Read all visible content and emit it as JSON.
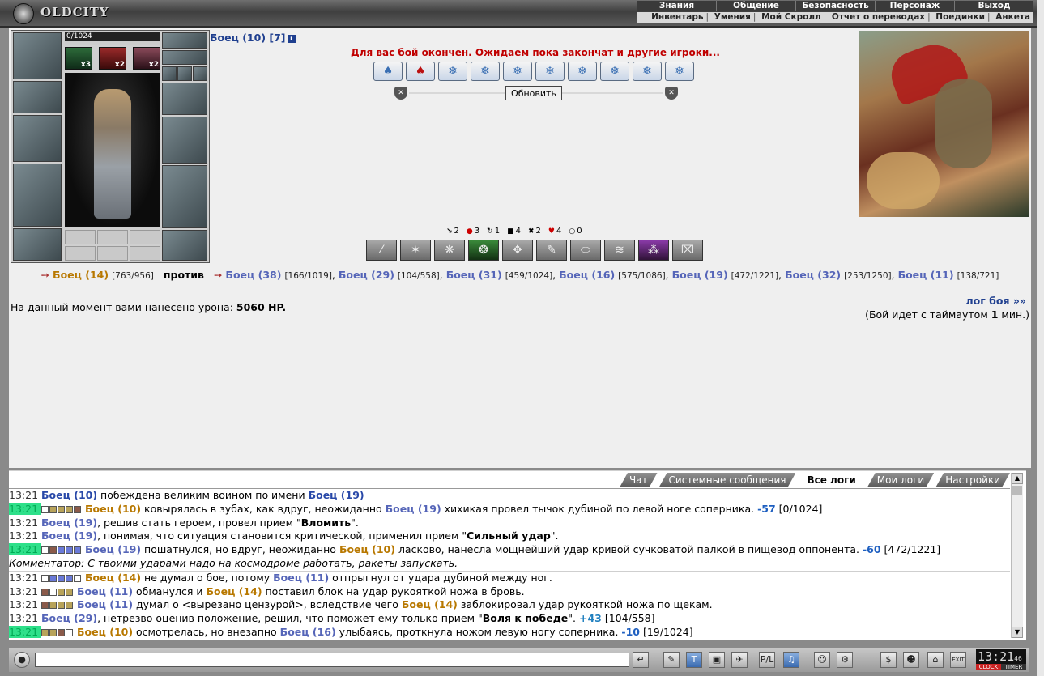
{
  "header": {
    "logo_text": "OLDCITY",
    "top_nav": [
      "Знания",
      "Общение",
      "Безопасность",
      "Персонаж",
      "Выход"
    ],
    "sub_nav": [
      "Инвентарь",
      "Умения",
      "Мой Скролл",
      "Отчет о переводах",
      "Поединки",
      "Анкета"
    ]
  },
  "character": {
    "hp_text": "0/1024",
    "hp_fraction": 0.0,
    "buffs": [
      {
        "count": "x3"
      },
      {
        "count": "x2"
      },
      {
        "count": "x2"
      }
    ],
    "name": "Боец (10) [7]",
    "info_icon": "i"
  },
  "battle": {
    "message": "Для вас бой окончен. Ожидаем пока закончат и другие игроки...",
    "refresh_label": "Обновить",
    "stats": [
      {
        "icon": "↘",
        "value": "2"
      },
      {
        "icon": "●",
        "value": "3",
        "color": "#c00000"
      },
      {
        "icon": "↻",
        "value": "1"
      },
      {
        "icon": "■",
        "value": "4"
      },
      {
        "icon": "✖",
        "value": "2"
      },
      {
        "icon": "♥",
        "value": "4",
        "color": "#c00000"
      },
      {
        "icon": "○",
        "value": "0"
      }
    ]
  },
  "versus": {
    "me": {
      "name": "Боец (14)",
      "hp": "[763/956]"
    },
    "vs_label": "против",
    "enemies": [
      {
        "name": "Боец (38)",
        "hp": "[166/1019]"
      },
      {
        "name": "Боец (29)",
        "hp": "[104/558]"
      },
      {
        "name": "Боец (31)",
        "hp": "[459/1024]"
      },
      {
        "name": "Боец (16)",
        "hp": "[575/1086]"
      },
      {
        "name": "Боец (19)",
        "hp": "[472/1221]"
      },
      {
        "name": "Боец (32)",
        "hp": "[253/1250]"
      },
      {
        "name": "Боец (11)",
        "hp": "[138/721]"
      }
    ]
  },
  "damage": {
    "prefix": "На данный момент вами нанесено урона:",
    "value": "5060 HP."
  },
  "battle_log_link": "лог боя »»",
  "timeout": {
    "prefix": "(Бой идет с таймаутом",
    "value": "1",
    "suffix": "мин.)"
  },
  "log_tabs": [
    "Чат",
    "Системные сообщения",
    "Все логи",
    "Мои логи",
    "Настройки"
  ],
  "log_active_tab": "Все логи",
  "log": {
    "r1": {
      "t": "13:21",
      "a": "Боец (10)",
      "b": " побеждена великим воином по имени ",
      "c": "Боец (19)"
    },
    "r2": {
      "t": "13:21",
      "a": "Боец (10)",
      "b": " ковырялась в зубах, как вдруг, неожиданно ",
      "c": "Боец (19)",
      "d": " хихикая провел тычок дубиной по левой ноге соперника. ",
      "e": "-57",
      "f": " [0/1024]"
    },
    "r3": {
      "t": "13:21",
      "a": "Боец (19)",
      "b": ", решив стать героем, провел прием \"",
      "c": "Вломить",
      "d": "\"."
    },
    "r4": {
      "t": "13:21",
      "a": "Боец (19)",
      "b": ", понимая, что ситуация становится критической, применил прием \"",
      "c": "Сильный удар",
      "d": "\"."
    },
    "r5": {
      "t": "13:21",
      "a": "Боец (19)",
      "b": " пошатнулся, но вдруг, неожиданно ",
      "c": "Боец (10)",
      "d": " ласково, нанесла мощнейший удар кривой сучковатой палкой в пищевод оппонента. ",
      "e": "-60",
      "f": " [472/1221]"
    },
    "r6": {
      "text": "Комментатор: С твоими ударами надо на космодроме работать, ракеты запускать."
    },
    "r7": {
      "t": "13:21",
      "a": "Боец (14)",
      "b": " не думал о бое, потому ",
      "c": "Боец (11)",
      "d": " отпрыгнул от удара дубиной между ног."
    },
    "r8": {
      "t": "13:21",
      "a": "Боец (11)",
      "b": " обманулся и ",
      "c": "Боец (14)",
      "d": " поставил блок на удар рукояткой ножа в бровь."
    },
    "r9": {
      "t": "13:21",
      "a": "Боец (11)",
      "b": " думал о <вырезано цензурой>, вследствие чего ",
      "c": "Боец (14)",
      "d": " заблокировал удар рукояткой ножа по щекам."
    },
    "r10": {
      "t": "13:21",
      "a": "Боец (29)",
      "b": ", нетрезво оценив положение, решил, что поможет ему только прием \"",
      "c": "Воля к победе",
      "d": "\". ",
      "e": "+43",
      "f": " [104/558]"
    },
    "r11": {
      "t": "13:21",
      "a": "Боец (10)",
      "b": " осмотрелась, но внезапно ",
      "c": "Боец (16)",
      "d": " улыбаясь, проткнула ножом левую ногу соперника. ",
      "e": "-10",
      "f": " [19/1024]"
    }
  },
  "clock": {
    "time": "13:21",
    "sec": "46",
    "label_clock": "CLOCK",
    "label_timer": "TIMER"
  },
  "bottom_icons": [
    "↵",
    "✎",
    "T",
    "▣",
    "✈",
    "P/L",
    "♫",
    "☺",
    "⚙",
    "$",
    "☻",
    "⌂",
    "EXIT"
  ]
}
